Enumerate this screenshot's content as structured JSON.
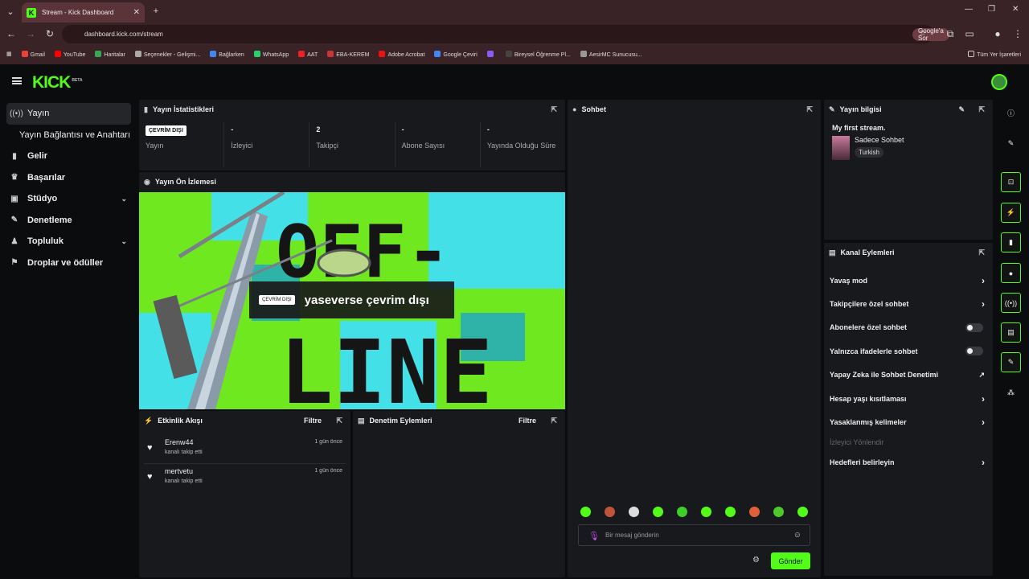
{
  "browser": {
    "tab_title": "Stream - Kick Dashboard",
    "url": "dashboard.kick.com/stream",
    "google_sor": "Google'a Sor",
    "bookmarks": [
      "Gmail",
      "YouTube",
      "Haritalar",
      "Seçenekler - Gelişmi...",
      "Bağlarken",
      "WhatsApp",
      "AAT",
      "EBA-KEREM",
      "Adobe Acrobat",
      "Google Çeviri",
      "",
      "Bireysel Öğrenme Pl...",
      "AesirMC Sunucusu..."
    ],
    "all_bookmarks": "Tüm Yer İşaretleri"
  },
  "brand": {
    "logo": "KICK",
    "beta": "BETA",
    "accent": "#53fc18"
  },
  "sidebar": {
    "items": [
      {
        "label": "Yayın",
        "icon": "stream-icon"
      },
      {
        "label": "Yayın Bağlantısı ve Anahtarı",
        "icon": ""
      },
      {
        "label": "Gelir",
        "icon": "chart-icon"
      },
      {
        "label": "Başarılar",
        "icon": "trophy-icon"
      },
      {
        "label": "Stüdyo",
        "icon": "studio-icon"
      },
      {
        "label": "Denetleme",
        "icon": "wrench-icon"
      },
      {
        "label": "Topluluk",
        "icon": "community-icon"
      },
      {
        "label": "Droplar ve ödüller",
        "icon": "gift-icon"
      }
    ]
  },
  "stats": {
    "title": "Yayın İstatistikleri",
    "badge": "ÇEVRİM DIŞI",
    "items": [
      {
        "value": "",
        "label": "Yayın"
      },
      {
        "value": "-",
        "label": "İzleyici"
      },
      {
        "value": "2",
        "label": "Takipçi"
      },
      {
        "value": "-",
        "label": "Abone Sayısı"
      },
      {
        "value": "-",
        "label": "Yayında Olduğu Süre"
      }
    ]
  },
  "preview": {
    "title": "Yayın Ön İzlemesi",
    "badge": "ÇEVRİM DIŞI",
    "overlay": "yaseverse çevrim dışı",
    "big1": "OFF-",
    "big2": "LINE"
  },
  "activity": {
    "title": "Etkinlik Akışı",
    "filter": "Filtre",
    "rows": [
      {
        "name": "Erenw44",
        "sub": "kanalı takip etti",
        "time": "1 gün önce"
      },
      {
        "name": "mertvetu",
        "sub": "kanalı takip etti",
        "time": "1 gün önce"
      }
    ]
  },
  "moderation": {
    "title": "Denetim Eylemleri",
    "filter": "Filtre"
  },
  "chat": {
    "title": "Sohbet",
    "placeholder": "Bir mesaj gönderin",
    "send": "Gönder"
  },
  "stream_info": {
    "title": "Yayın bilgisi",
    "stream_title": "My first stream.",
    "category": "Sadece Sohbet",
    "language": "Turkish"
  },
  "channel_actions": {
    "title": "Kanal Eylemleri",
    "items": [
      {
        "label": "Yavaş mod",
        "type": "arrow"
      },
      {
        "label": "Takipçilere özel sohbet",
        "type": "arrow"
      },
      {
        "label": "Abonelere özel sohbet",
        "type": "toggle"
      },
      {
        "label": "Yalnızca ifadelerle sohbet",
        "type": "toggle"
      },
      {
        "label": "Yapay Zeka ile Sohbet Denetimi",
        "type": "external"
      },
      {
        "label": "Hesap yaşı kısıtlaması",
        "type": "arrow"
      },
      {
        "label": "Yasaklanmış kelimeler",
        "type": "arrow"
      },
      {
        "label": "İzleyici Yönlendir",
        "type": "disabled"
      },
      {
        "label": "Hedefleri belirleyin",
        "type": "arrow"
      }
    ]
  }
}
